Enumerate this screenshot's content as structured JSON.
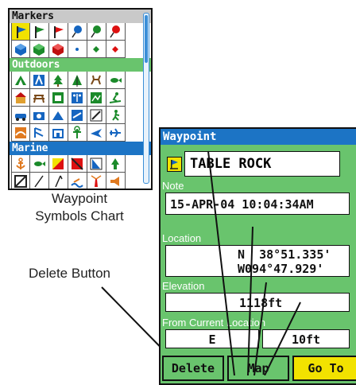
{
  "symbols_chart": {
    "categories": [
      {
        "name": "Markers",
        "rows": 2
      },
      {
        "name": "Outdoors",
        "rows": 4
      },
      {
        "name": "Marine",
        "rows": 2
      }
    ]
  },
  "captions": {
    "chart_line1": "Waypoint",
    "chart_line2": "Symbols Chart",
    "delete_button_callout": "Delete Button"
  },
  "waypoint": {
    "title": "Waypoint",
    "name": "TABLE ROCK",
    "icon": "flag-waypoint-icon",
    "note_label": "Note",
    "note_value": "15-APR-04 10:04:34AM",
    "location_label": "Location",
    "location_line1": "N  38°51.335'",
    "location_line2": "W094°47.929'",
    "elevation_label": "Elevation",
    "elevation_value": "1118ft",
    "from_label": "From Current Location",
    "direction_value": "E",
    "distance_value": "10ft",
    "buttons": {
      "delete": "Delete",
      "map": "Map",
      "goto": "Go To"
    }
  },
  "colors": {
    "title_bar": "#1c74c5",
    "panel_green": "#69c46d",
    "panel_gray": "#c9c9c9",
    "highlight_yellow": "#f2e200"
  }
}
